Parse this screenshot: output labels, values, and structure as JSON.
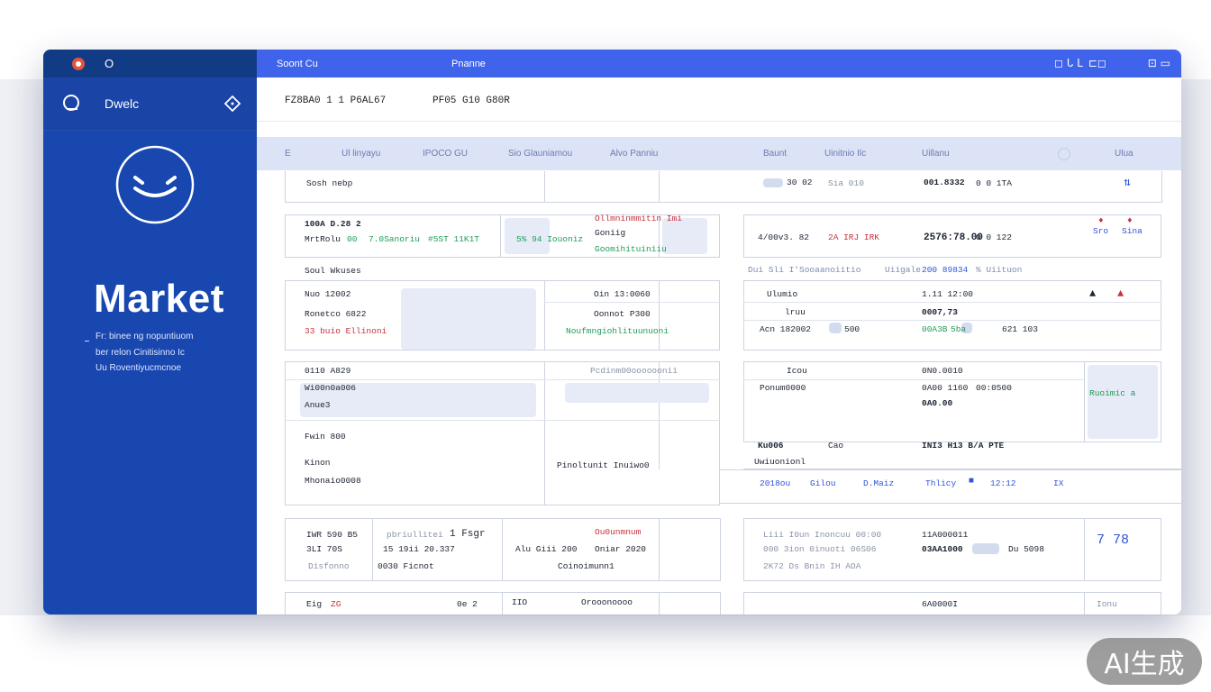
{
  "window": {
    "app_label": "O",
    "topbar": {
      "left": "Soont Cu",
      "center": "Pnanne"
    },
    "window_controls": [
      "◻ ᒐ ᒪ",
      "⊏◻",
      "⊡ ▭"
    ]
  },
  "sidebar": {
    "nav_label": "Dwelc",
    "title": "Market",
    "description": [
      "Fr: binee ng nopuntiuom",
      "ber relon Cinitisinno Ic",
      "Uu Roventiyucmcnoe"
    ]
  },
  "subbar": {
    "left": "FZ8BA0 1 1 P6AL67",
    "right": "PF05 G10 G80R"
  },
  "column_headers": [
    "E",
    "Ul linyayu",
    "IPOCO GU",
    "Sio Glauniamou",
    "Alvo Panniu",
    "Baunt",
    "Uinitnio Ilc",
    "Uillanu",
    "Ulua"
  ],
  "rows": [
    {
      "name": "Sosh nebp",
      "mid": "30 02",
      "mid2": "Sia 010",
      "value": "001.8332",
      "tag": "0 0 1TA"
    },
    {
      "left1": "100A D.28 2",
      "left2": "MrtRolu",
      "g1": "00",
      "g2": "7.0Sanoriu",
      "g3": "#5ST 11K1T",
      "g4": "5% 94 Iouoniz",
      "c1": "Ollmninmmitin Imi",
      "c2": "Goniig",
      "c3": "Goomihituiniiu",
      "r1": "4/00v3. 82",
      "r2": "2A IRJ IRK",
      "r3": "2576:78.00",
      "r4": "0 0 122",
      "ic1": "Sro",
      "ic2": "Sina"
    },
    {
      "section_left": "Soul Wkuses",
      "section_right": "Dui Sli I'Sooaanoiitio",
      "section_mid": "Uiigale",
      "section_val": "200 89834",
      "section_tail": "% Uiituon"
    },
    {
      "a1": "Nuo 12002",
      "a2": "Ronetco 6822",
      "a3": "33 buio Ellinoni",
      "b1": "Oin 13:0060",
      "b2": "Oonnot P300",
      "b3": "Noufmngiohlituunuoni",
      "c1": "Ulumio",
      "c2": "lruu",
      "c3": "Acn 182002",
      "c4": "500",
      "d1": "1.11 12:00",
      "d2": "0007,73",
      "d3": "00A3B",
      "d4": "5ba",
      "d5": "621 103"
    },
    {
      "a1": "0110 A829",
      "a2": "Wi00n0a006",
      "a3": "Anue3",
      "b1": "Pcdinm00oooooonii",
      "c1": "Icou",
      "c2": "Ponum0000",
      "d1": "0N0.0010",
      "d2": "0A00 1160",
      "d3": "0A0.00",
      "d4": "00:0500",
      "d5": "Ruoimic a"
    },
    {
      "a1": "Fwin 800",
      "a2": "Kinon",
      "a3": "Mhonaio0008",
      "b1": "Pinoltunit Inuiwo0",
      "c1": "Ku006",
      "c2": "Uwiuonionl",
      "c3": "Cao",
      "d1": "INI3 H13 B/A PTE",
      "footer": [
        "2018ou",
        "Gilou",
        "D.Maiz",
        "Thlicy",
        "12:12",
        "IX"
      ]
    },
    {
      "a1": "IWR 590 B5",
      "a2": "3LI 70S",
      "a3": "Disfonno",
      "b1": "pbriullitei",
      "b2": "15 19ii 20.337",
      "b3": "0030 Ficnot",
      "b4": "1 Fsgr",
      "c1": "Alu Giii 200",
      "c2": "Ou0unmnum",
      "c3": "Coinoimunn1",
      "c4": "Oniar 2020",
      "d1": "Liii I0un Inoncuu 00:00",
      "d2": "000 3ion 0inuoti 06S06",
      "d3": "2K72 Ds Bnin IH AOA",
      "e1": "11A000011",
      "e2": "03AA1000",
      "e3": "Du 5098",
      "e4": "7 78"
    },
    {
      "a1": "Eig",
      "a2": "ZG",
      "b1": "0e 2",
      "b2": "IIO",
      "c1": "Orooonoooo",
      "d1": "6A0000I",
      "d2": "Ionu"
    }
  ],
  "watermark": "AI生成"
}
